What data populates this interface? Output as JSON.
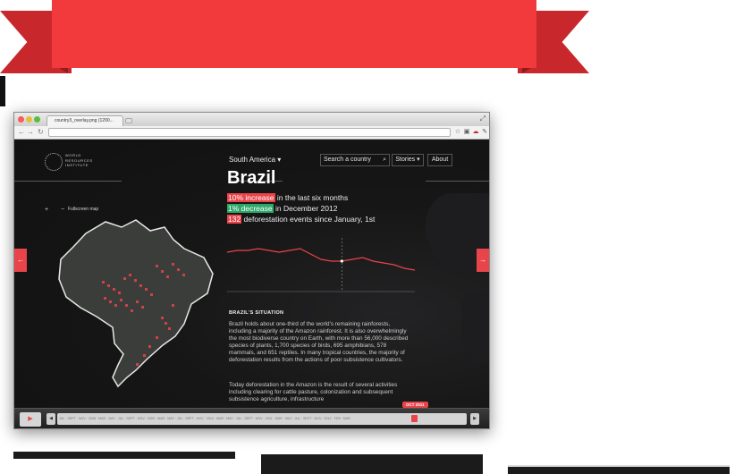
{
  "browser": {
    "tab_title": "country3_overlay.png (1290...",
    "icons": [
      "back-icon",
      "forward-icon",
      "reload-icon",
      "expand-icon",
      "bookmark-icon",
      "extension-icon",
      "wrench-icon"
    ]
  },
  "site": {
    "logo_text": "WORLD\nRESOURCES\nINSTITUTE",
    "region_select": "South America ▾",
    "search_label": "Search a country",
    "stories_label": "Stories ▾",
    "about_label": "About",
    "zoom_controls": "+ −",
    "fullscreen_label": "Fullscreen map"
  },
  "country": {
    "name": "Brazil",
    "stats": [
      {
        "highlight": "10% increase",
        "text": " in the last six months",
        "color": "#e8444a"
      },
      {
        "highlight": "1% decrease",
        "text": " in December 2012",
        "color": "#2ea868"
      },
      {
        "highlight": "132",
        "text": " deforestation events since January, 1st",
        "color": "#e8444a"
      }
    ],
    "situation_title": "BRAZIL'S SITUATION",
    "paragraph_1": "Brazil holds about one-third of the world's remaining rainforests, including a majority of the Amazon rainforest. It is also overwhelmingly the most biodiverse country on Earth, with more than 56,000 described species of plants, 1,700 species of birds, 695 amphibians, 578 mammals, and 651 reptiles. In many tropical countries, the majority of deforestation results from the actions of poor subsistence cultivators.",
    "paragraph_2": "Today deforestation in the Amazon is the result of several activities including clearing for cattle pasture, colonization and subsequent subsistence agriculture, infrastructure"
  },
  "trend_chart": {
    "type": "line",
    "values": [
      22,
      23,
      23,
      24,
      23,
      22,
      23,
      24,
      21,
      18,
      17,
      17,
      18,
      19,
      17,
      16,
      15,
      13,
      12
    ],
    "marker_index": 11,
    "ylim": [
      0,
      30
    ]
  },
  "timeline": {
    "play_icon": "▶",
    "prev_icon": "◀",
    "next_icon": "▶",
    "ticks": "JUL · SEPT · NOV · 2008 · MAR · MAY · JUL · SEPT · NOV · 2009 · MAR · MAY · JUL · SEPT · NOV · 2010 · MAR · MAY · JUL · SEPT · NOV · 2011 · MAR · MAY · JUL · SEPT · NOV · 2012 · FEB · MAR",
    "current": "OCT 2011"
  },
  "colors": {
    "ribbon": "#f23a3c",
    "accent_red": "#e8444a",
    "accent_green": "#2ea868"
  }
}
